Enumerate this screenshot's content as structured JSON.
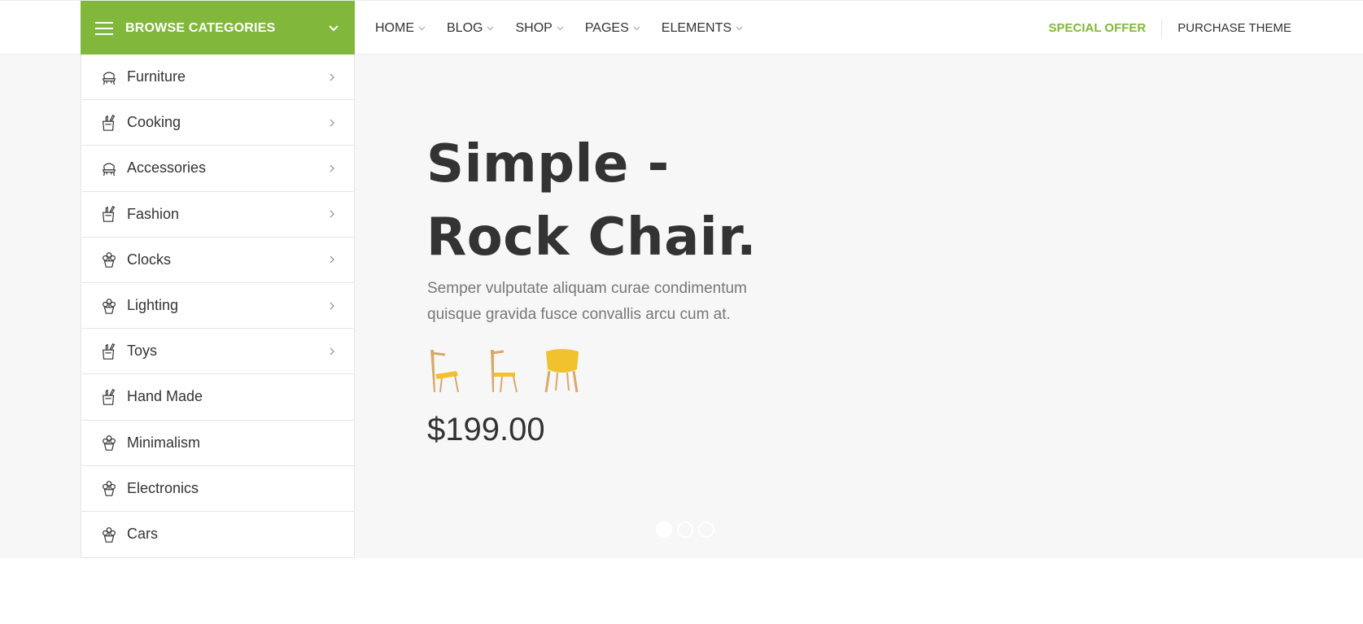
{
  "header": {
    "browse_label": "BROWSE CATEGORIES",
    "nav": [
      {
        "label": "HOME"
      },
      {
        "label": "BLOG"
      },
      {
        "label": "SHOP"
      },
      {
        "label": "PAGES"
      },
      {
        "label": "ELEMENTS"
      }
    ],
    "special_offer": "SPECIAL OFFER",
    "purchase_theme": "PURCHASE THEME"
  },
  "sidebar": {
    "items": [
      {
        "label": "Furniture",
        "icon": "chair-icon",
        "has_submenu": true
      },
      {
        "label": "Cooking",
        "icon": "kitchen-knives-icon",
        "has_submenu": true
      },
      {
        "label": "Accessories",
        "icon": "chair-icon",
        "has_submenu": true
      },
      {
        "label": "Fashion",
        "icon": "kitchen-knives-icon",
        "has_submenu": true
      },
      {
        "label": "Clocks",
        "icon": "plant-pot-icon",
        "has_submenu": true
      },
      {
        "label": "Lighting",
        "icon": "plant-pot-icon",
        "has_submenu": true
      },
      {
        "label": "Toys",
        "icon": "kitchen-knives-icon",
        "has_submenu": true
      },
      {
        "label": "Hand Made",
        "icon": "kitchen-knives-icon",
        "has_submenu": false
      },
      {
        "label": "Minimalism",
        "icon": "plant-pot-icon",
        "has_submenu": false
      },
      {
        "label": "Electronics",
        "icon": "plant-pot-icon",
        "has_submenu": false
      },
      {
        "label": "Cars",
        "icon": "plant-pot-icon",
        "has_submenu": false
      }
    ]
  },
  "hero": {
    "title_line1": "Simple -",
    "title_line2": "Rock Chair.",
    "description": "Semper vulputate aliquam curae condimentum quisque gravida fusce convallis arcu cum at.",
    "price": "$199.00",
    "thumbnails": [
      {
        "name": "chair-thumb-1"
      },
      {
        "name": "chair-thumb-2"
      },
      {
        "name": "chair-thumb-3"
      }
    ],
    "slides_count": 3,
    "active_slide": 1
  },
  "colors": {
    "accent": "#81b73a",
    "text": "#333333",
    "muted": "#777777",
    "hero_bg": "#f7f7f7"
  }
}
